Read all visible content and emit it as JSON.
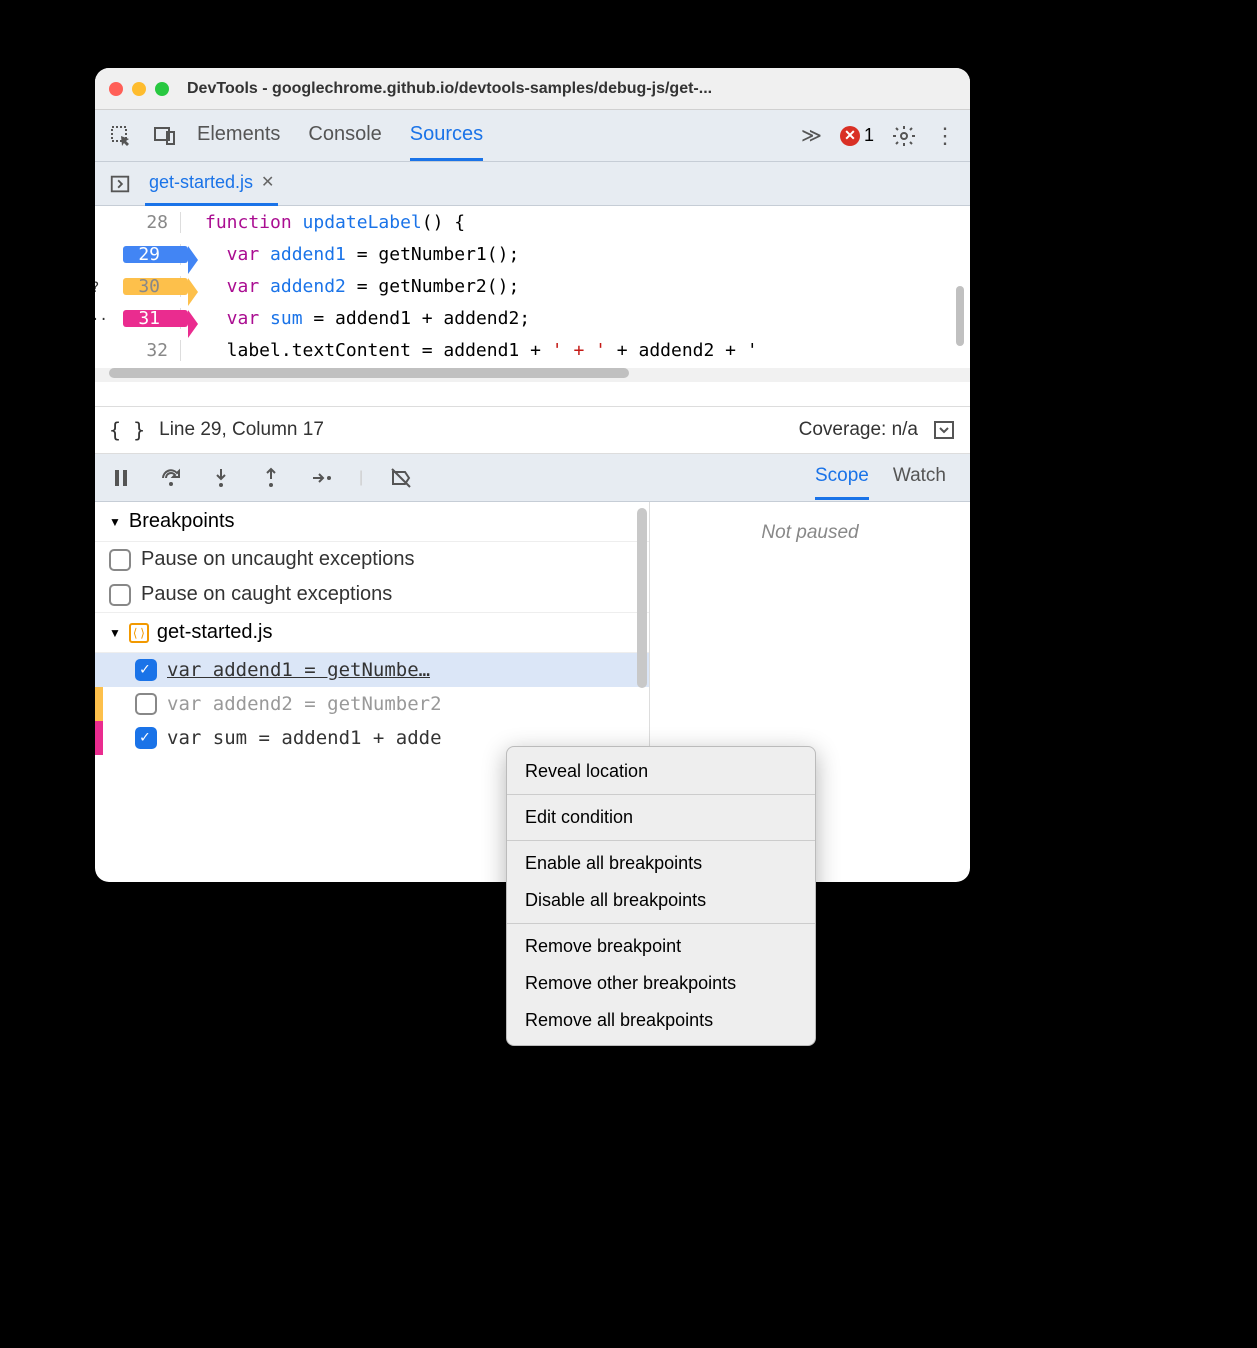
{
  "window": {
    "title": "DevTools - googlechrome.github.io/devtools-samples/debug-js/get-..."
  },
  "main_tabs": {
    "elements": "Elements",
    "console": "Console",
    "sources": "Sources"
  },
  "error_count": "1",
  "file_tab": {
    "name": "get-started.js"
  },
  "code": {
    "lines": [
      {
        "num": "28",
        "bp": null,
        "t1": "function ",
        "t2": "updateLabel",
        "t3": "() {"
      },
      {
        "num": "29",
        "bp": "blue",
        "prefix": "",
        "t1": "  var ",
        "t2": "addend1",
        "t3": " = getNumber1();"
      },
      {
        "num": "30",
        "bp": "orange",
        "prefix": "?",
        "t1": "  var ",
        "t2": "addend2",
        "t3": " = getNumber2();"
      },
      {
        "num": "31",
        "bp": "pink",
        "prefix": "··",
        "t1": "  var ",
        "t2": "sum",
        "t3": " = addend1 + addend2;"
      },
      {
        "num": "32",
        "bp": null,
        "t1": "  label.textContent = addend1 + ",
        "t2": "' + '",
        "t3": " + addend2 + '"
      }
    ]
  },
  "status": {
    "position": "Line 29, Column 17",
    "coverage": "Coverage: n/a"
  },
  "scope_tabs": {
    "scope": "Scope",
    "watch": "Watch"
  },
  "scope_msg": "Not paused",
  "breakpoints": {
    "header": "Breakpoints",
    "uncaught": "Pause on uncaught exceptions",
    "caught": "Pause on caught exceptions",
    "file": "get-started.js",
    "items": [
      {
        "checked": true,
        "text": "var addend1 = getNumbe…",
        "stripe": "",
        "selected": true
      },
      {
        "checked": false,
        "text": "var addend2 = getNumber2",
        "stripe": "#fdc04b",
        "dim": true
      },
      {
        "checked": true,
        "text": "var sum = addend1 + adde",
        "stripe": "#ea2c8f"
      }
    ]
  },
  "context_menu": {
    "g1": [
      "Reveal location"
    ],
    "g2": [
      "Edit condition"
    ],
    "g3": [
      "Enable all breakpoints",
      "Disable all breakpoints"
    ],
    "g4": [
      "Remove breakpoint",
      "Remove other breakpoints",
      "Remove all breakpoints"
    ]
  }
}
